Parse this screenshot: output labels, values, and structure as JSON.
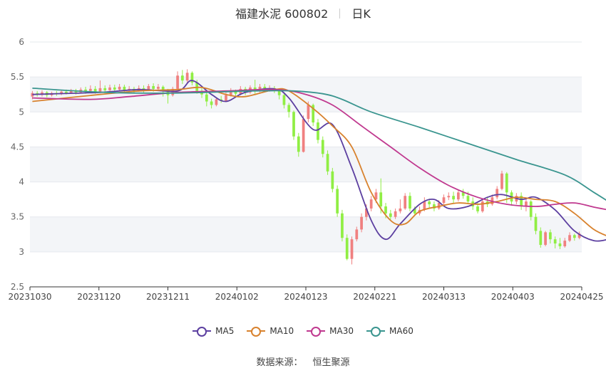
{
  "header": {
    "stock": "福建水泥 600802",
    "period": "日K"
  },
  "source": {
    "label": "数据来源：",
    "name": "恒生聚源"
  },
  "colors": {
    "up": "#f08080",
    "down": "#90ee44",
    "grid_band": "#f3f5f8"
  },
  "chart_data": {
    "type": "candlestick",
    "x_tick_labels": [
      "20231030",
      "20231120",
      "20231211",
      "20240102",
      "20240123",
      "20240221",
      "20240313",
      "20240403",
      "20240425"
    ],
    "y_ticks": [
      2.5,
      3,
      3.5,
      4,
      4.5,
      5,
      5.5,
      6
    ],
    "ylim": [
      2.5,
      6
    ],
    "grid": true,
    "legend_position": "bottom",
    "candles": [
      [
        5.22,
        5.27,
        5.18,
        5.3
      ],
      [
        5.27,
        5.25,
        5.22,
        5.3
      ],
      [
        5.25,
        5.28,
        5.22,
        5.31
      ],
      [
        5.28,
        5.24,
        5.21,
        5.3
      ],
      [
        5.24,
        5.27,
        5.22,
        5.29
      ],
      [
        5.27,
        5.26,
        5.23,
        5.3
      ],
      [
        5.26,
        5.29,
        5.24,
        5.31
      ],
      [
        5.29,
        5.27,
        5.25,
        5.32
      ],
      [
        5.27,
        5.3,
        5.26,
        5.33
      ],
      [
        5.3,
        5.28,
        5.25,
        5.33
      ],
      [
        5.28,
        5.32,
        5.27,
        5.35
      ],
      [
        5.32,
        5.3,
        5.26,
        5.36
      ],
      [
        5.3,
        5.33,
        5.28,
        5.38
      ],
      [
        5.33,
        5.29,
        5.26,
        5.37
      ],
      [
        5.29,
        5.34,
        5.28,
        5.45
      ],
      [
        5.34,
        5.31,
        5.27,
        5.38
      ],
      [
        5.31,
        5.35,
        5.3,
        5.39
      ],
      [
        5.35,
        5.32,
        5.29,
        5.39
      ],
      [
        5.32,
        5.36,
        5.3,
        5.4
      ],
      [
        5.36,
        5.31,
        5.27,
        5.39
      ],
      [
        5.31,
        5.33,
        5.28,
        5.37
      ],
      [
        5.33,
        5.3,
        5.26,
        5.36
      ],
      [
        5.3,
        5.34,
        5.29,
        5.38
      ],
      [
        5.34,
        5.32,
        5.28,
        5.38
      ],
      [
        5.32,
        5.37,
        5.31,
        5.4
      ],
      [
        5.37,
        5.33,
        5.29,
        5.41
      ],
      [
        5.33,
        5.36,
        5.31,
        5.4
      ],
      [
        5.36,
        5.31,
        5.22,
        5.38
      ],
      [
        5.31,
        5.24,
        5.12,
        5.33
      ],
      [
        5.24,
        5.33,
        5.22,
        5.36
      ],
      [
        5.33,
        5.52,
        5.31,
        5.58
      ],
      [
        5.52,
        5.45,
        5.4,
        5.6
      ],
      [
        5.45,
        5.56,
        5.42,
        5.61
      ],
      [
        5.56,
        5.42,
        5.38,
        5.58
      ],
      [
        5.42,
        5.3,
        5.26,
        5.46
      ],
      [
        5.3,
        5.25,
        5.2,
        5.34
      ],
      [
        5.25,
        5.15,
        5.08,
        5.28
      ],
      [
        5.15,
        5.1,
        5.05,
        5.19
      ],
      [
        5.1,
        5.18,
        5.08,
        5.21
      ],
      [
        5.18,
        5.16,
        5.13,
        5.23
      ],
      [
        5.16,
        5.24,
        5.14,
        5.28
      ],
      [
        5.24,
        5.3,
        5.22,
        5.34
      ],
      [
        5.3,
        5.26,
        5.22,
        5.32
      ],
      [
        5.26,
        5.33,
        5.24,
        5.37
      ],
      [
        5.33,
        5.28,
        5.24,
        5.36
      ],
      [
        5.28,
        5.35,
        5.26,
        5.38
      ],
      [
        5.35,
        5.3,
        5.26,
        5.46
      ],
      [
        5.3,
        5.36,
        5.28,
        5.4
      ],
      [
        5.36,
        5.32,
        5.28,
        5.4
      ],
      [
        5.32,
        5.34,
        5.29,
        5.38
      ],
      [
        5.34,
        5.3,
        5.27,
        5.37
      ],
      [
        5.3,
        5.24,
        5.18,
        5.33
      ],
      [
        5.24,
        5.1,
        5.05,
        5.26
      ],
      [
        5.1,
        5.0,
        4.92,
        5.13
      ],
      [
        5.0,
        4.65,
        4.6,
        5.02
      ],
      [
        4.65,
        4.43,
        4.36,
        4.7
      ],
      [
        4.43,
        4.9,
        4.42,
        4.95
      ],
      [
        4.9,
        5.1,
        4.85,
        5.15
      ],
      [
        5.1,
        4.85,
        4.8,
        5.12
      ],
      [
        4.85,
        4.6,
        4.55,
        4.9
      ],
      [
        4.6,
        4.4,
        4.35,
        4.65
      ],
      [
        4.4,
        4.15,
        4.1,
        4.45
      ],
      [
        4.15,
        3.9,
        3.85,
        4.2
      ],
      [
        3.9,
        3.55,
        3.5,
        3.95
      ],
      [
        3.55,
        3.2,
        3.15,
        3.6
      ],
      [
        3.2,
        2.9,
        2.88,
        3.25
      ],
      [
        2.9,
        3.18,
        2.82,
        3.22
      ],
      [
        3.18,
        3.32,
        3.15,
        3.36
      ],
      [
        3.32,
        3.5,
        3.28,
        3.55
      ],
      [
        3.5,
        3.62,
        3.45,
        3.68
      ],
      [
        3.62,
        3.75,
        3.58,
        3.8
      ],
      [
        3.75,
        3.85,
        3.7,
        3.9
      ],
      [
        3.85,
        3.65,
        3.55,
        4.05
      ],
      [
        3.65,
        3.55,
        3.48,
        3.7
      ],
      [
        3.55,
        3.5,
        3.46,
        3.6
      ],
      [
        3.5,
        3.58,
        3.47,
        3.62
      ],
      [
        3.58,
        3.62,
        3.55,
        3.75
      ],
      [
        3.62,
        3.8,
        3.6,
        3.84
      ],
      [
        3.8,
        3.62,
        3.58,
        3.85
      ],
      [
        3.62,
        3.55,
        3.52,
        3.65
      ],
      [
        3.55,
        3.6,
        3.52,
        3.65
      ],
      [
        3.6,
        3.72,
        3.58,
        3.78
      ],
      [
        3.72,
        3.68,
        3.62,
        3.76
      ],
      [
        3.68,
        3.62,
        3.58,
        3.72
      ],
      [
        3.62,
        3.7,
        3.6,
        3.74
      ],
      [
        3.7,
        3.78,
        3.67,
        3.82
      ],
      [
        3.78,
        3.8,
        3.74,
        3.85
      ],
      [
        3.8,
        3.75,
        3.7,
        3.86
      ],
      [
        3.75,
        3.85,
        3.72,
        3.88
      ],
      [
        3.85,
        3.8,
        3.76,
        3.9
      ],
      [
        3.8,
        3.72,
        3.68,
        3.86
      ],
      [
        3.72,
        3.65,
        3.6,
        3.78
      ],
      [
        3.65,
        3.58,
        3.55,
        3.7
      ],
      [
        3.58,
        3.72,
        3.56,
        3.75
      ],
      [
        3.72,
        3.68,
        3.64,
        3.78
      ],
      [
        3.68,
        3.78,
        3.66,
        3.82
      ],
      [
        3.78,
        3.9,
        3.75,
        3.94
      ],
      [
        3.9,
        4.12,
        3.88,
        4.16
      ],
      [
        4.12,
        3.85,
        3.7,
        4.14
      ],
      [
        3.85,
        3.72,
        3.66,
        3.88
      ],
      [
        3.72,
        3.8,
        3.68,
        3.84
      ],
      [
        3.8,
        3.65,
        3.6,
        3.85
      ],
      [
        3.65,
        3.72,
        3.58,
        3.76
      ],
      [
        3.72,
        3.5,
        3.45,
        3.74
      ],
      [
        3.5,
        3.3,
        3.25,
        3.55
      ],
      [
        3.3,
        3.1,
        3.06,
        3.35
      ],
      [
        3.1,
        3.28,
        3.08,
        3.3
      ],
      [
        3.28,
        3.18,
        3.12,
        3.32
      ],
      [
        3.18,
        3.12,
        3.05,
        3.22
      ],
      [
        3.12,
        3.08,
        3.04,
        3.2
      ],
      [
        3.08,
        3.16,
        3.06,
        3.2
      ],
      [
        3.16,
        3.24,
        3.14,
        3.28
      ],
      [
        3.24,
        3.2,
        3.16,
        3.26
      ],
      [
        3.2,
        3.26,
        3.18,
        3.29
      ]
    ],
    "series": [
      {
        "name": "MA5",
        "color": "#5c3fa0",
        "anchors": [
          [
            0,
            5.25
          ],
          [
            14,
            5.28
          ],
          [
            22,
            5.32
          ],
          [
            30,
            5.3
          ],
          [
            33,
            5.45
          ],
          [
            37,
            5.25
          ],
          [
            40,
            5.15
          ],
          [
            44,
            5.28
          ],
          [
            50,
            5.33
          ],
          [
            53,
            5.2
          ],
          [
            58,
            4.75
          ],
          [
            62,
            4.82
          ],
          [
            66,
            4.2
          ],
          [
            70,
            3.45
          ],
          [
            73,
            3.18
          ],
          [
            76,
            3.4
          ],
          [
            80,
            3.68
          ],
          [
            83,
            3.75
          ],
          [
            86,
            3.62
          ],
          [
            90,
            3.65
          ],
          [
            94,
            3.78
          ],
          [
            97,
            3.82
          ],
          [
            101,
            3.75
          ],
          [
            104,
            3.78
          ],
          [
            108,
            3.6
          ],
          [
            112,
            3.3
          ],
          [
            116,
            3.16
          ],
          [
            119,
            3.18
          ]
        ]
      },
      {
        "name": "MA10",
        "color": "#d8822e",
        "anchors": [
          [
            0,
            5.15
          ],
          [
            14,
            5.25
          ],
          [
            22,
            5.3
          ],
          [
            30,
            5.32
          ],
          [
            35,
            5.35
          ],
          [
            40,
            5.25
          ],
          [
            44,
            5.22
          ],
          [
            50,
            5.32
          ],
          [
            53,
            5.3
          ],
          [
            58,
            5.05
          ],
          [
            62,
            4.8
          ],
          [
            66,
            4.5
          ],
          [
            70,
            3.85
          ],
          [
            74,
            3.45
          ],
          [
            77,
            3.4
          ],
          [
            80,
            3.58
          ],
          [
            84,
            3.65
          ],
          [
            88,
            3.7
          ],
          [
            92,
            3.68
          ],
          [
            96,
            3.72
          ],
          [
            100,
            3.78
          ],
          [
            104,
            3.75
          ],
          [
            108,
            3.72
          ],
          [
            112,
            3.55
          ],
          [
            116,
            3.32
          ],
          [
            119,
            3.22
          ]
        ]
      },
      {
        "name": "MA30",
        "color": "#c0398f",
        "anchors": [
          [
            0,
            5.2
          ],
          [
            12,
            5.18
          ],
          [
            20,
            5.22
          ],
          [
            30,
            5.28
          ],
          [
            40,
            5.3
          ],
          [
            50,
            5.32
          ],
          [
            56,
            5.26
          ],
          [
            62,
            5.1
          ],
          [
            68,
            4.8
          ],
          [
            74,
            4.5
          ],
          [
            80,
            4.2
          ],
          [
            86,
            3.95
          ],
          [
            92,
            3.78
          ],
          [
            98,
            3.68
          ],
          [
            104,
            3.65
          ],
          [
            108,
            3.68
          ],
          [
            112,
            3.7
          ],
          [
            116,
            3.64
          ],
          [
            119,
            3.6
          ]
        ]
      },
      {
        "name": "MA60",
        "color": "#3a958f",
        "anchors": [
          [
            0,
            5.34
          ],
          [
            15,
            5.28
          ],
          [
            30,
            5.27
          ],
          [
            45,
            5.3
          ],
          [
            54,
            5.3
          ],
          [
            60,
            5.26
          ],
          [
            64,
            5.18
          ],
          [
            70,
            5.0
          ],
          [
            80,
            4.78
          ],
          [
            90,
            4.55
          ],
          [
            100,
            4.32
          ],
          [
            110,
            4.1
          ],
          [
            116,
            3.85
          ],
          [
            119,
            3.72
          ]
        ]
      }
    ]
  }
}
